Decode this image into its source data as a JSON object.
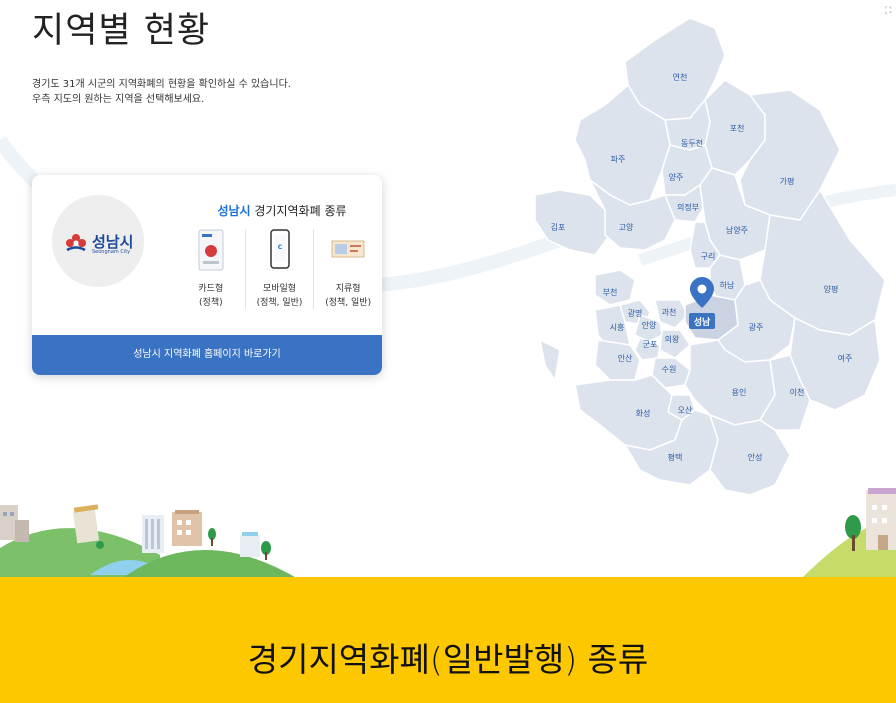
{
  "page": {
    "title": "지역별 현황",
    "description_line1": "경기도 31개 시군의 지역화폐의 현황을 확인하실 수 있습니다.",
    "description_line2": "우측 지도의 원하는 지역을 선택해보세요."
  },
  "card": {
    "logo_name": "성남시",
    "logo_sub": "Seongnam City",
    "heading_city": "성남시",
    "heading_rest": " 경기지역화폐 종류",
    "types": [
      {
        "label": "카드형",
        "sub": "(정책)",
        "icon": "card-icon"
      },
      {
        "label": "모바일형",
        "sub": "(정책, 일반)",
        "icon": "mobile-icon"
      },
      {
        "label": "지류형",
        "sub": "(정책, 일반)",
        "icon": "paper-voucher-icon"
      }
    ],
    "button_label": "성남시 지역화폐 홈페이지 바로가기"
  },
  "map": {
    "selected_region": "성남",
    "regions": {
      "yeoncheon": "연천",
      "pocheon": "포천",
      "dongducheon": "동두천",
      "paju": "파주",
      "yangju": "양주",
      "gapyeong": "가평",
      "uijeongbu": "의정부",
      "gimpo": "김포",
      "goyang": "고양",
      "namyangju": "남양주",
      "guri": "구리",
      "hanam": "하남",
      "bucheon": "부천",
      "gwangmyeong": "광명",
      "gwacheon": "과천",
      "siheung": "시흥",
      "anyang": "안양",
      "gunpo": "군포",
      "uiwang": "의왕",
      "gwangju": "광주",
      "yangpyeong": "양평",
      "ansan": "안산",
      "suwon": "수원",
      "yeoju": "여주",
      "yongin": "용인",
      "icheon": "이천",
      "hwaseong": "화성",
      "osan": "오산",
      "pyeongtaek": "평택",
      "anseong": "안성"
    }
  },
  "section_title": "경기지역화폐(일반발행) 종류",
  "colors": {
    "accent_blue": "#3a73c4",
    "map_fill": "#dde3ec",
    "selected_fill": "#3a73c4",
    "banner_yellow": "#fec800"
  }
}
